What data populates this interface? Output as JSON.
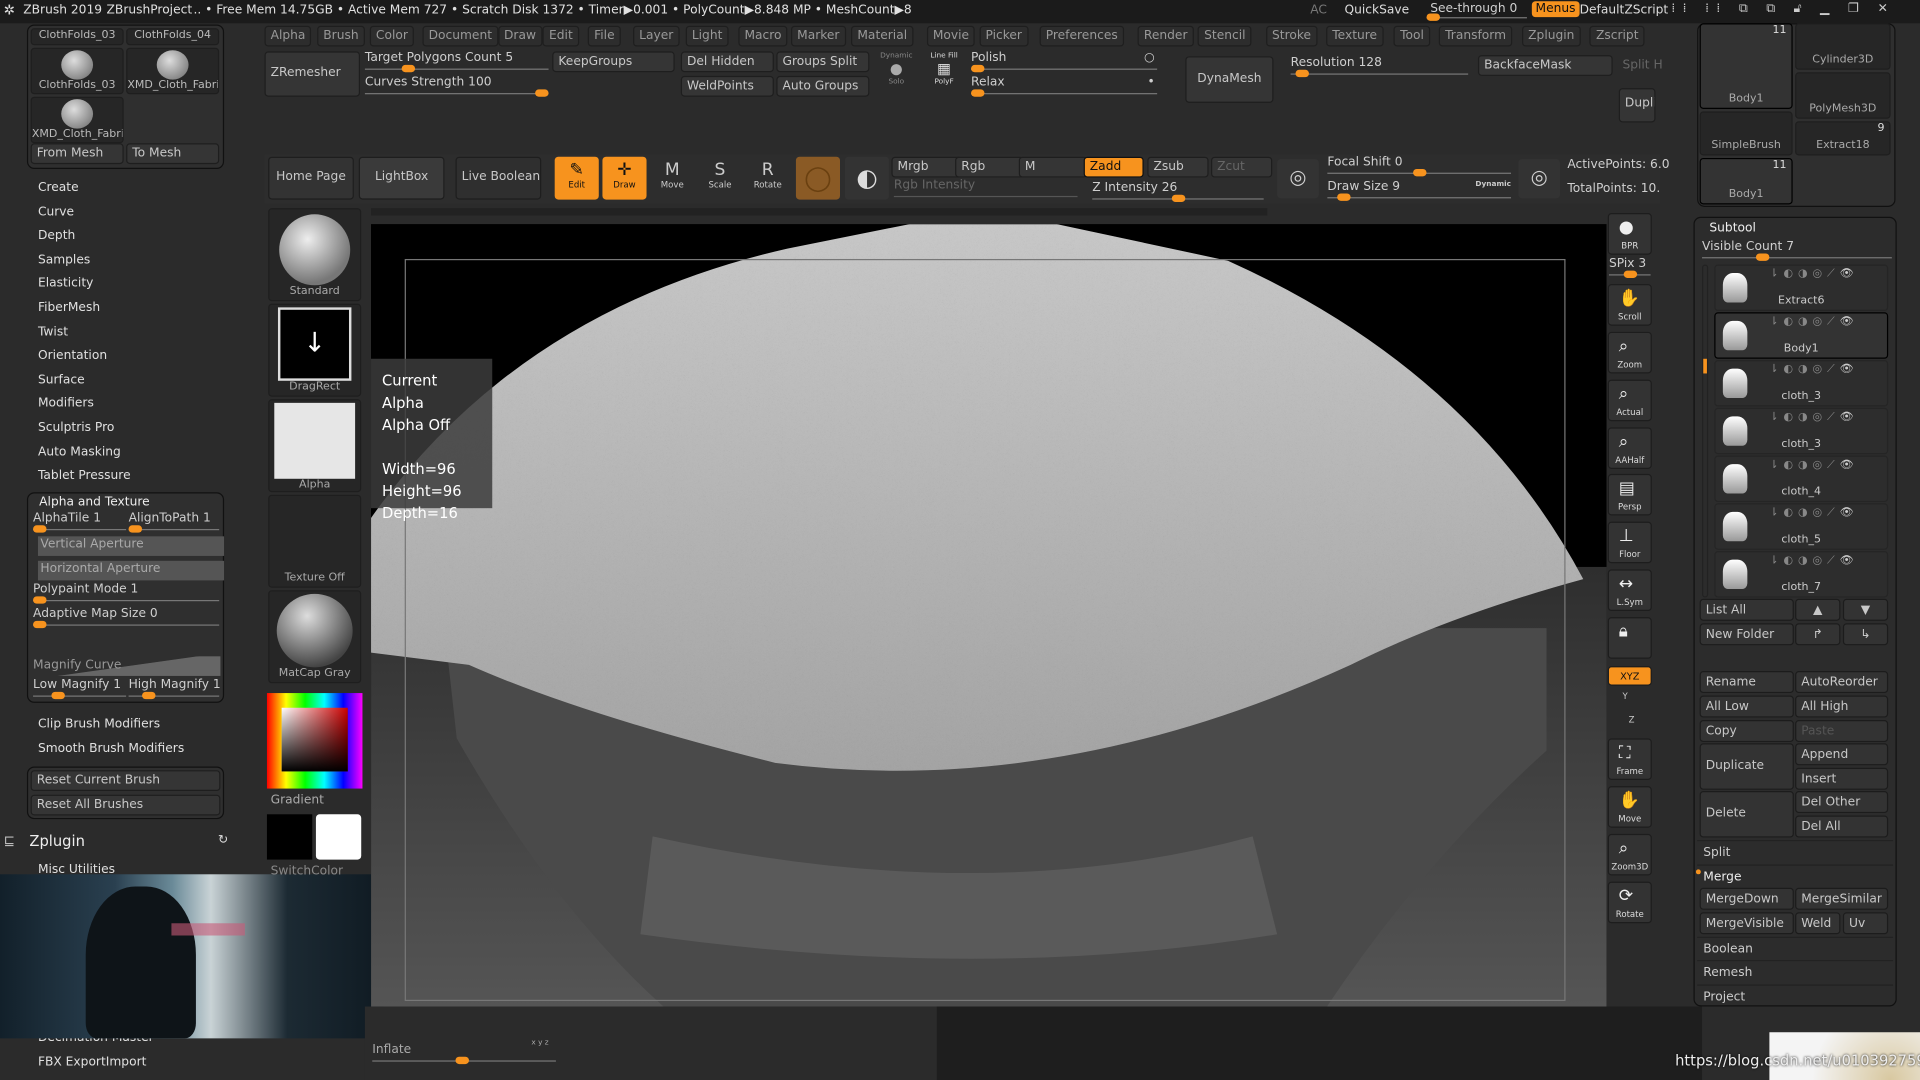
{
  "titlebar": {
    "app": "ZBrush 2019",
    "project": "ZBrushProject",
    "stats": ".. • Free Mem 14.75GB • Active Mem 727 • Scratch Disk 1372 •  Timer▶0.001 • PolyCount▶8.848 MP  • MeshCount▶8",
    "ac": "AC",
    "quicksave": "QuickSave",
    "see_through": "See-through  0",
    "see_through_value": 0,
    "menus": "Menus",
    "script": "DefaultZScript"
  },
  "menubar": [
    "Alpha",
    "Brush",
    "Color",
    "Document",
    "Draw",
    "Edit",
    "File",
    "Layer",
    "Light",
    "Macro",
    "Marker",
    "Material",
    "Movie",
    "Picker",
    "Preferences",
    "Render",
    "Stencil",
    "Stroke",
    "Texture",
    "Tool",
    "Transform",
    "Zplugin",
    "Zscript"
  ],
  "palette": {
    "zremesher": "ZRemesher",
    "target_polys": "Target Polygons Count 5",
    "curves_strength": "Curves Strength 100",
    "keepgroups": "KeepGroups",
    "del_hidden": "Del Hidden",
    "groups_split": "Groups Split",
    "weldpoints": "WeldPoints",
    "auto_groups": "Auto Groups",
    "dynamic": "Dynamic",
    "solo": "Solo",
    "line_fill": "Line Fill",
    "polyf": "PolyF",
    "polish": "Polish",
    "relax": "Relax",
    "dynamesh": "DynaMesh",
    "resolution": "Resolution 128",
    "backfacemask": "BackfaceMask",
    "split": "Split H",
    "dupli": "Dupli"
  },
  "toolbar": {
    "home": "Home Page",
    "lightbox": "LightBox",
    "live_boolean": "Live Boolean",
    "edit": "Edit",
    "draw": "Draw",
    "move": "Move",
    "scale": "Scale",
    "rotate": "Rotate",
    "mrgb": "Mrgb",
    "rgb": "Rgb",
    "m": "M",
    "zadd": "Zadd",
    "zsub": "Zsub",
    "zcut": "Zcut",
    "rgb_intensity": "Rgb Intensity",
    "z_intensity": "Z Intensity 26",
    "focal_shift": "Focal Shift 0",
    "draw_size": "Draw Size 9",
    "dynamic": "Dynamic",
    "active_points": "ActivePoints: 6.0",
    "total_points": "TotalPoints: 10.",
    "accent": "#f7931e"
  },
  "brushes": {
    "items": [
      "ClothFolds_03",
      "ClothFolds_04",
      "ClothFolds_03",
      "XMD_Cloth_Fabri",
      "XMD_Cloth_Fabri"
    ],
    "from_mesh": "From Mesh",
    "to_mesh": "To Mesh"
  },
  "brush_menu": [
    "Create",
    "Curve",
    "Depth",
    "Samples",
    "Elasticity",
    "FiberMesh",
    "Twist",
    "Orientation",
    "Surface",
    "Modifiers",
    "Sculptris Pro",
    "Auto Masking",
    "Tablet Pressure"
  ],
  "alpha_texture": {
    "title": "Alpha and Texture",
    "alphatile": "AlphaTile 1",
    "aligntopath": "AlignToPath 1",
    "vertical": "Vertical Aperture",
    "horizontal": "Horizontal Aperture",
    "polypaint": "Polypaint Mode 1",
    "adaptive": "Adaptive Map Size 0",
    "magnify_curve": "Magnify Curve",
    "low_magnify": "Low Magnify 1",
    "high_magnify": "High Magnify 1"
  },
  "brush_menu2": [
    "Clip Brush Modifiers",
    "Smooth Brush Modifiers"
  ],
  "reset": {
    "current": "Reset Current Brush",
    "all": "Reset All Brushes"
  },
  "zplugin": {
    "title": "Zplugin",
    "items": [
      "Misc Utilities",
      "Decimation Master",
      "FBX ExportImport"
    ]
  },
  "tools_col": {
    "standard": "Standard",
    "dragrect": "DragRect",
    "alpha": "Alpha",
    "texture": "Texture Off",
    "matcap": "MatCap Gray",
    "gradient": "Gradient",
    "switchcolor": "SwitchColor"
  },
  "tooltip": {
    "title": "Current Alpha",
    "state": "Alpha Off",
    "width": "Width=96",
    "height": "Height=96",
    "depth": "Depth=16"
  },
  "shelf": [
    "BPR",
    "SPix 3",
    "Scroll",
    "Zoom",
    "Actual",
    "AAHalf",
    "Persp",
    "Floor",
    "L.Sym",
    "",
    "XYZ",
    "Y",
    "Z",
    "Frame",
    "Move",
    "Zoom3D",
    "Rotate"
  ],
  "tool_thumbs": [
    {
      "label": "Body1",
      "count": "11"
    },
    {
      "label": "Cylinder3D"
    },
    {
      "label": "PolyMesh3D"
    },
    {
      "label": "SimpleBrush"
    },
    {
      "label": "Extract18",
      "count": "9"
    },
    {
      "label": "Body1",
      "count": "11"
    }
  ],
  "subtool": {
    "title": "Subtool",
    "visible_count": "Visible Count 7",
    "items": [
      "Extract6",
      "Body1",
      "cloth_3",
      "cloth_3",
      "cloth_4",
      "cloth_5",
      "cloth_7"
    ],
    "selected": 1,
    "list_all": "List All",
    "new_folder": "New Folder",
    "rename": "Rename",
    "autoreorder": "AutoReorder",
    "all_low": "All Low",
    "all_high": "All High",
    "copy": "Copy",
    "paste": "Paste",
    "duplicate": "Duplicate",
    "append": "Append",
    "insert": "Insert",
    "delete": "Delete",
    "del_other": "Del Other",
    "del_all": "Del All",
    "split": "Split",
    "merge": "Merge",
    "mergedown": "MergeDown",
    "mergesimilar": "MergeSimilar",
    "mergevisible": "MergeVisible",
    "weld": "Weld",
    "uv": "Uv",
    "boolean": "Boolean",
    "remesh": "Remesh",
    "project": "Project"
  },
  "bottom": {
    "inflate": "Inflate",
    "xyz": "x y z",
    "watermark": "https://blog.csdn.net/u010392759"
  }
}
